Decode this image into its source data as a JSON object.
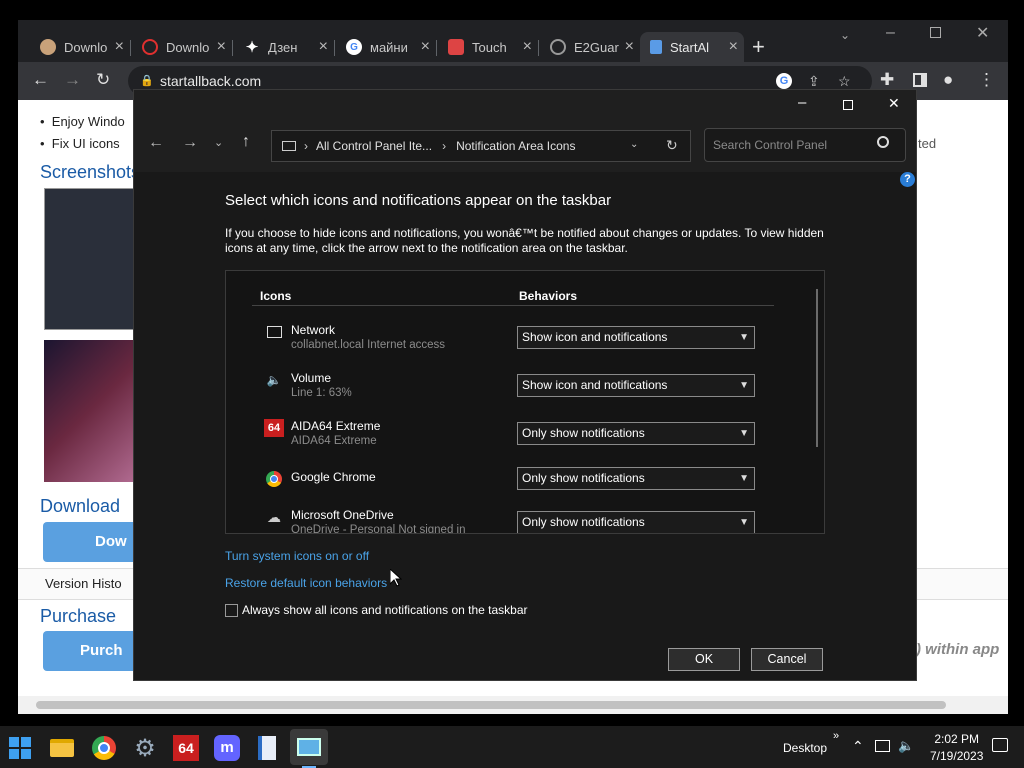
{
  "browser": {
    "tabs": [
      {
        "title": "Downlo",
        "favicon": "cat"
      },
      {
        "title": "Downlo",
        "favicon": "opera"
      },
      {
        "title": "Дзен",
        "favicon": "dzen"
      },
      {
        "title": "майни",
        "favicon": "google"
      },
      {
        "title": "Touch",
        "favicon": "store"
      },
      {
        "title": "E2Guar",
        "favicon": "globe"
      },
      {
        "title": "StartAl",
        "favicon": "startallback"
      }
    ],
    "url": "startallback.com"
  },
  "page_behind": {
    "bullet1": "Enjoy Windo",
    "bullet2": "Fix UI icons",
    "bullet2_tail": "ted",
    "screenshots_heading": "Screenshots",
    "download_heading": "Download",
    "download_button": "Dow",
    "version_history": "Version Histo",
    "purchase_heading": "Purchase",
    "purchase_button": "Purch",
    "italic_tail": ") within app"
  },
  "dialog": {
    "address_parts": [
      "All Control Panel Ite...",
      "Notification Area Icons"
    ],
    "search_placeholder": "Search Control Panel",
    "heading": "Select which icons and notifications appear on the taskbar",
    "description": "If you choose to hide icons and notifications, you wonâ€™t be notified about changes or updates. To view hidden icons at any time, click the arrow next to the notification area on the taskbar.",
    "col_icons": "Icons",
    "col_behaviors": "Behaviors",
    "rows": [
      {
        "name": "Network",
        "sub": "collabnet.local Internet access",
        "behavior": "Show icon and notifications",
        "icon": "network-icon"
      },
      {
        "name": "Volume",
        "sub": "Line 1: 63%",
        "behavior": "Show icon and notifications",
        "icon": "volume-icon"
      },
      {
        "name": "AIDA64 Extreme",
        "sub": "AIDA64 Extreme",
        "behavior": "Only show notifications",
        "icon": "aida64-icon",
        "icon_text": "64"
      },
      {
        "name": "Google Chrome",
        "sub": "",
        "behavior": "Only show notifications",
        "icon": "chrome-icon"
      },
      {
        "name": "Microsoft OneDrive",
        "sub": "OneDrive - Personal Not signed in",
        "behavior": "Only show notifications",
        "icon": "onedrive-icon"
      }
    ],
    "link_system_icons": "Turn system icons on or off",
    "link_restore": "Restore default icon behaviors",
    "checkbox_label": "Always show all icons and notifications on the taskbar",
    "ok": "OK",
    "cancel": "Cancel"
  },
  "taskbar": {
    "aida_text": "64",
    "desktop_label": "Desktop",
    "time": "2:02 PM",
    "date": "7/19/2023"
  },
  "colors": {
    "link": "#4aa3e8",
    "help": "#2a7dd6"
  }
}
